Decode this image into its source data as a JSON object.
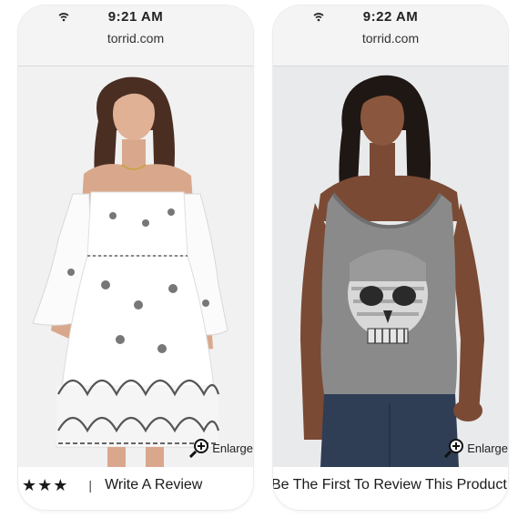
{
  "left_screen": {
    "status": {
      "time": "9:21 AM"
    },
    "browser": {
      "url": "torrid.com"
    },
    "product": {
      "image_label": "",
      "enlarge_label": "Enlarge",
      "rating_stars": "★★★",
      "divider": "|",
      "review_link": "Write A Review"
    }
  },
  "right_screen": {
    "status": {
      "time": "9:22 AM"
    },
    "browser": {
      "url": "torrid.com"
    },
    "product": {
      "enlarge_label": "Enlarge",
      "review_link": "Be The First To Review This Product"
    }
  },
  "icons": {
    "status_wifi": "wifi-icon",
    "enlarge": "magnify-plus-icon"
  },
  "colors": {
    "status_bar": "#f4f4f4",
    "text": "#1a1a1a",
    "dress_white": "#ffffff",
    "tank_grey": "#8a8a8a",
    "jeans_blue": "#2f3d55"
  }
}
